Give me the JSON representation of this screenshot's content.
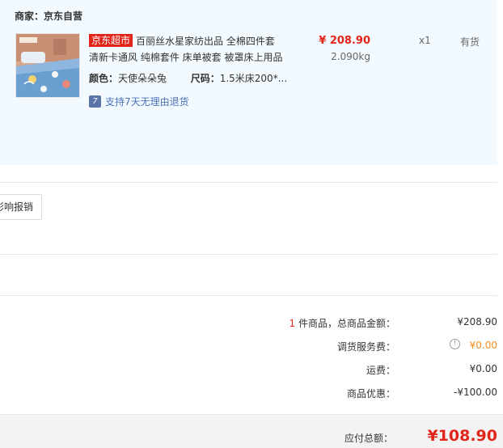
{
  "seller": {
    "label": "商家：京东自营"
  },
  "product": {
    "badge": "京东超市",
    "title_line1": "百丽丝水星家纺出品 全棉四件套",
    "title_line2": "清新卡通风 纯棉套件 床单被套 被罩床上用品",
    "price": "¥ 208.90",
    "weight": "2.090kg",
    "quantity": "x1",
    "stock": "有货",
    "color_label": "颜色：",
    "color_value": "天使朵朵兔",
    "size_label": "尺码：",
    "size_value": "1.5米床200*...",
    "return_policy": "支持7天无理由退货",
    "return_icon": "7"
  },
  "invoice": {
    "button_label": "影响报销"
  },
  "summary": {
    "count": "1",
    "count_suffix": " 件商品，总商品金额：",
    "total_goods": "¥208.90",
    "transfer_label": "调货服务费：",
    "transfer_value": "¥0.00",
    "shipping_label": "运费：",
    "shipping_value": "¥0.00",
    "discount_label": "商品优惠：",
    "discount_value": "-¥100.00"
  },
  "footer": {
    "payable_label": "应付总额：",
    "payable_value": "¥108.90"
  },
  "colors": {
    "accent_red": "#e1251b",
    "panel_bg": "#f3faff",
    "link_blue": "#4a72b9",
    "orange": "#f58f1e"
  }
}
